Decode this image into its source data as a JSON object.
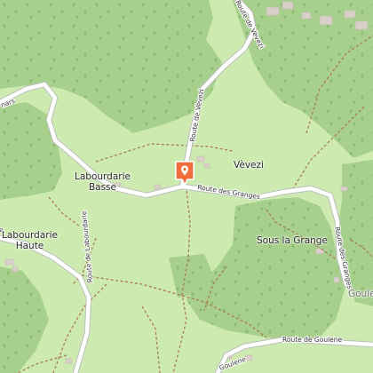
{
  "map": {
    "places": [
      {
        "id": "labourdarie-basse",
        "lines": [
          "Labourdarie",
          "Basse"
        ]
      },
      {
        "id": "labourdarie-haute",
        "lines": [
          "Labourdarie",
          "Haute"
        ]
      },
      {
        "id": "vevezi",
        "lines": [
          "Vèvezi"
        ]
      },
      {
        "id": "sous-la-grange",
        "lines": [
          "Sous la Grange"
        ]
      },
      {
        "id": "goulene-edge",
        "lines": [
          "Goule"
        ]
      }
    ],
    "roads": {
      "route_de_vevezi_north": "Route de Vèvezi",
      "route_de_vevezi_south": "Route de Vèvezi",
      "route_des_granges_west": "Route des Granges",
      "route_des_granges_east": "Route des Granges",
      "route_de_labourdarie": "Route de Labourdarie",
      "route_de_goulene": "Route de Goulene",
      "goulene_edge": "Goulene",
      "west_edge_road": "nars",
      "west_edge_road2": "e"
    },
    "marker": {
      "icon": "map-pin-icon",
      "color": "#f26b3a"
    },
    "colors": {
      "forest": "#a8d08d",
      "meadow": "#cdebb0",
      "track": "#a87b4f",
      "road": "#ffffff",
      "road_casing": "#bdbdbd",
      "building": "#d9d0c9"
    }
  }
}
